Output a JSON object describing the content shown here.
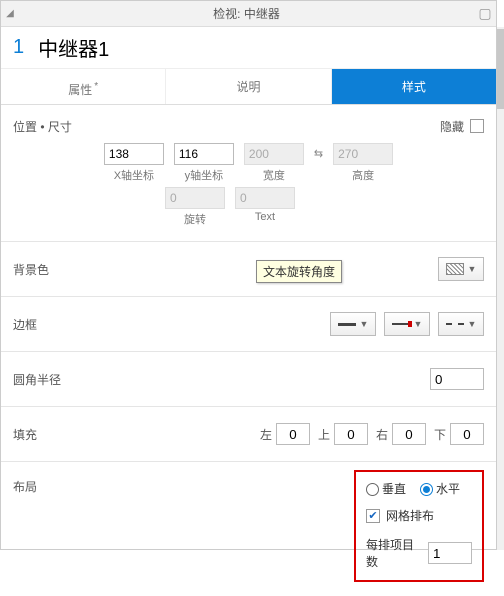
{
  "titlebar": {
    "title": "检视: 中继器"
  },
  "object": {
    "index": "1",
    "name": "中继器1"
  },
  "tabs": {
    "props": "属性",
    "notes": "说明",
    "style": "样式",
    "dirty_marker": "*"
  },
  "position": {
    "header": "位置 • 尺寸",
    "hide": "隐藏",
    "x_value": "138",
    "x_label": "X轴坐标",
    "y_value": "116",
    "y_label": "y轴坐标",
    "w_value": "200",
    "w_label": "宽度",
    "h_value": "270",
    "h_label": "高度",
    "rot_value": "0",
    "rot_label": "旋转",
    "text_rot_value": "0",
    "text_rot_label": "Text",
    "tooltip": "文本旋转角度"
  },
  "bgcolor": {
    "label": "背景色"
  },
  "border": {
    "label": "边框"
  },
  "radius": {
    "label": "圆角半径",
    "value": "0"
  },
  "padding": {
    "label": "填充",
    "left_lbl": "左",
    "left": "0",
    "top_lbl": "上",
    "top": "0",
    "right_lbl": "右",
    "right": "0",
    "bottom_lbl": "下",
    "bottom": "0"
  },
  "layout": {
    "label": "布局",
    "vertical": "垂直",
    "horizontal": "水平",
    "grid": "网格排布",
    "per_row_label": "每排项目数",
    "per_row_value": "1"
  }
}
